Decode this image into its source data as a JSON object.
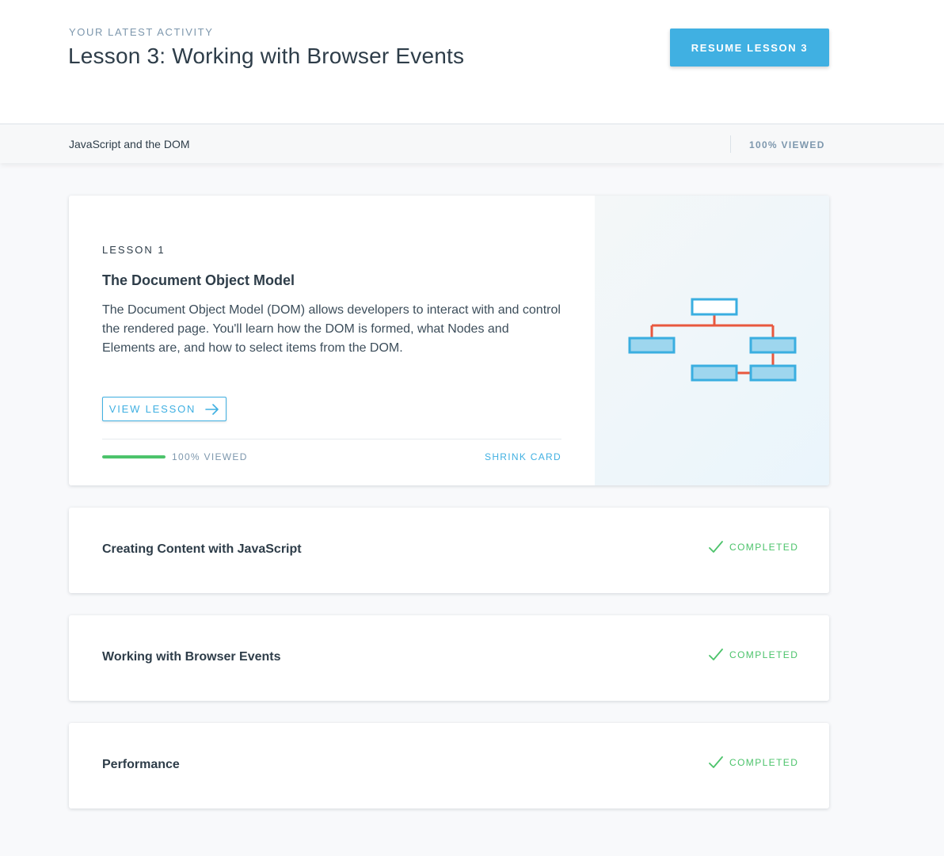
{
  "header": {
    "eyebrow": "YOUR LATEST ACTIVITY",
    "title": "Lesson 3: Working with Browser Events",
    "resume_label": "RESUME LESSON 3"
  },
  "course": {
    "title": "JavaScript and the DOM",
    "progress_label": "100% VIEWED"
  },
  "lessons": [
    {
      "number_label": "LESSON 1",
      "title": "The Document Object Model",
      "description": "The Document Object Model (DOM) allows developers to interact with and control the rendered page. You'll learn how the DOM is formed, what Nodes and Elements are, and how to select items from the DOM.",
      "view_label": "VIEW LESSON",
      "progress_fraction": 1.0,
      "progress_label": "100% VIEWED",
      "shrink_label": "SHRINK CARD",
      "icon": "dom-tree-illustration"
    },
    {
      "title": "Creating Content with JavaScript",
      "status": "COMPLETED",
      "icon": "check-icon"
    },
    {
      "title": "Working with Browser Events",
      "status": "COMPLETED",
      "icon": "check-icon"
    },
    {
      "title": "Performance",
      "status": "COMPLETED",
      "icon": "check-icon"
    }
  ],
  "colors": {
    "accent": "#40b0e2",
    "success": "#4cc36b",
    "tree_line": "#e8583e",
    "tree_box": "#9ed6ee"
  }
}
